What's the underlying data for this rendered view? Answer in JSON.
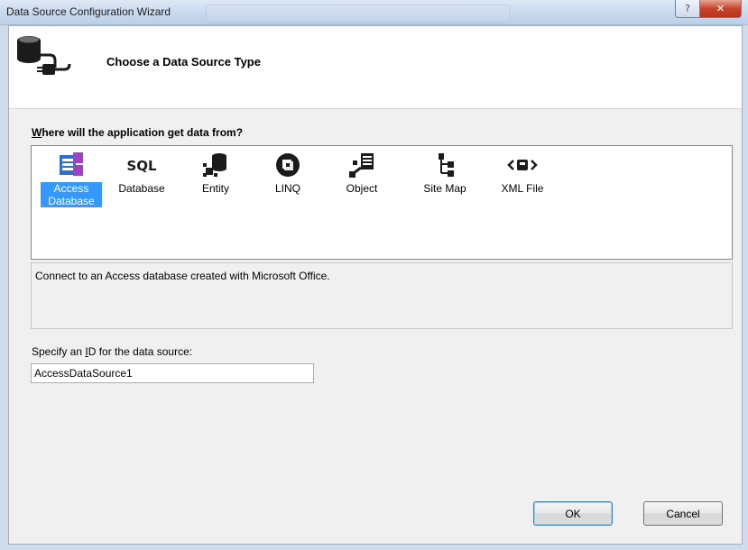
{
  "window": {
    "title": "Data Source Configuration Wizard",
    "help_glyph": "?",
    "close_glyph": "✕"
  },
  "header": {
    "title": "Choose a Data Source Type",
    "icon": "database-plug-icon"
  },
  "question": {
    "mnemonic": "W",
    "rest": "here will the application get data from?"
  },
  "sources": [
    {
      "label": "Access Database",
      "icon": "access-database-icon",
      "selected": true
    },
    {
      "label": "Database",
      "icon": "sql-database-icon",
      "selected": false
    },
    {
      "label": "Entity",
      "icon": "entity-icon",
      "selected": false
    },
    {
      "label": "LINQ",
      "icon": "linq-icon",
      "selected": false
    },
    {
      "label": "Object",
      "icon": "object-icon",
      "selected": false
    },
    {
      "label": "Site Map",
      "icon": "site-map-icon",
      "selected": false
    },
    {
      "label": "XML File",
      "icon": "xml-file-icon",
      "selected": false
    }
  ],
  "description": "Connect to an Access database created with Microsoft Office.",
  "id_field": {
    "label_before": "Specify an ",
    "label_mnemonic": "I",
    "label_after": "D for the data source:",
    "value": "AccessDataSource1"
  },
  "buttons": {
    "ok": "OK",
    "cancel": "Cancel"
  },
  "colors": {
    "selection": "#3399ff",
    "access_purple": "#a040c8",
    "access_blue": "#2f6fd0"
  }
}
